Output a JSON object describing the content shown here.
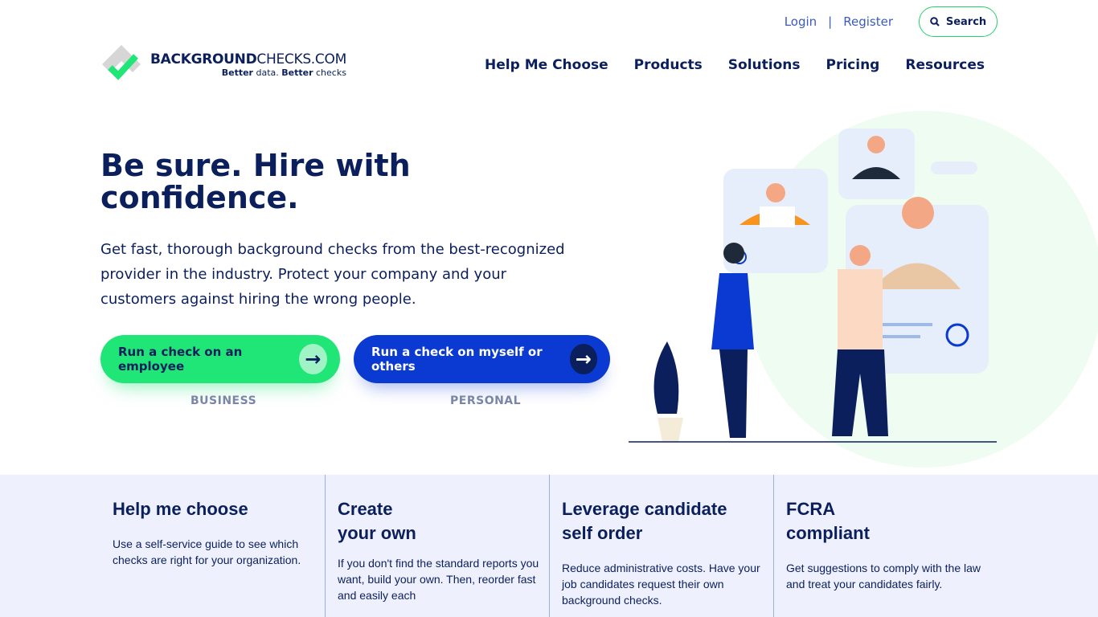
{
  "header": {
    "login": "Login",
    "separator": "|",
    "register": "Register",
    "search": "Search",
    "logo": {
      "bold": "BACKGROUND",
      "light": "CHECKS.COM",
      "tagline_b1": "Better",
      "tagline_1": " data. ",
      "tagline_b2": "Better",
      "tagline_2": " checks"
    },
    "nav": [
      "Help Me Choose",
      "Products",
      "Solutions",
      "Pricing",
      "Resources"
    ]
  },
  "hero": {
    "title": "Be sure. Hire with confidence.",
    "lead": "Get fast, thorough background checks from the best-recognized provider in the industry. Protect your company and your customers against hiring the wrong people.",
    "buttons": [
      {
        "label": "Run a check on an employee",
        "caption": "BUSINESS"
      },
      {
        "label": "Run a check on myself or others",
        "caption": "PERSONAL"
      }
    ]
  },
  "features": [
    {
      "title": "Help me choose",
      "text": "Use a self-service guide to see which checks are right for your organization."
    },
    {
      "title": "Create your own",
      "text": "If you don't find the standard reports you want, build your own. Then, reorder fast and easily each"
    },
    {
      "title": "Leverage candidate self order",
      "text": "Reduce administrative costs. Have your job candidates request their own background checks."
    },
    {
      "title": "FCRA compliant",
      "text": "Get suggestions to comply with the law and treat your candidates fairly."
    }
  ],
  "colors": {
    "green": "#1fe677",
    "blue": "#0a3ad1",
    "navy": "#0b1f5c",
    "band": "#eef1fd"
  }
}
